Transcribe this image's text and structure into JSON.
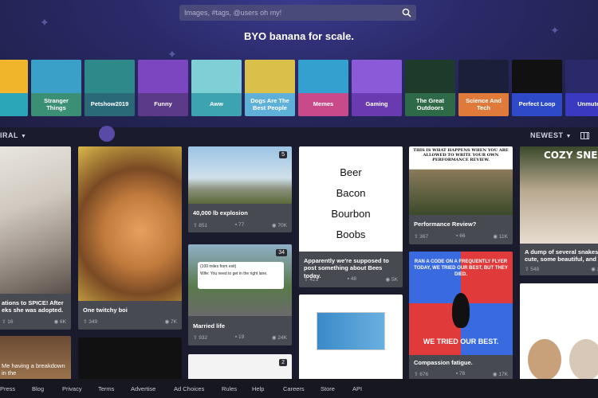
{
  "search": {
    "placeholder": "Images, #tags, @users oh my!"
  },
  "tagline": "BYO banana for scale.",
  "tags": [
    {
      "label": "",
      "art": "#f0b52a",
      "bg": "#2aa6b8"
    },
    {
      "label": "Stranger Things",
      "art": "#3aa0c8",
      "bg": "#3a8f74"
    },
    {
      "label": "Petshow2019",
      "art": "#2e8a8a",
      "bg": "#2a6a78"
    },
    {
      "label": "Funny",
      "art": "#7b46c0",
      "bg": "#5b3a8a"
    },
    {
      "label": "Aww",
      "art": "#7fd0d6",
      "bg": "#3ea3b0"
    },
    {
      "label": "Dogs Are The Best People",
      "art": "#d8c04a",
      "bg": "#5fb0d8"
    },
    {
      "label": "Memes",
      "art": "#33a0d0",
      "bg": "#c94a8a"
    },
    {
      "label": "Gaming",
      "art": "#8a5ad8",
      "bg": "#6a3ab0"
    },
    {
      "label": "The Great Outdoors",
      "art": "#1e3a2a",
      "bg": "#2f6a48"
    },
    {
      "label": "Science And Tech",
      "art": "#1a1f3a",
      "bg": "#e07a3a"
    },
    {
      "label": "Perfect Loop",
      "art": "#111",
      "bg": "#2f4ac8"
    },
    {
      "label": "Unmuted",
      "art": "#2a2a6a",
      "bg": "#3a3ac0"
    }
  ],
  "sort_left": "IRAL",
  "sort_right": "NEWEST",
  "cards": [
    {
      "title": "ations to SPICE! After eks she was adopted.",
      "ups": "16",
      "comments": "",
      "views": "6K",
      "badge": ""
    },
    {
      "title": "One twitchy boi",
      "ups": "349",
      "comments": "",
      "views": "7K",
      "badge": ""
    },
    {
      "title": "40,000 lb explosion",
      "ups": "851",
      "comments": "77",
      "views": "70K",
      "badge": "5"
    },
    {
      "title": "Married life",
      "ups": "932",
      "comments": "19",
      "views": "24K",
      "badge": "34"
    },
    {
      "title": "Apparently we're supposed to post something about Bees today.",
      "ups": "421",
      "comments": "48",
      "views": "5K",
      "badge": ""
    },
    {
      "title": "Performance Review?",
      "ups": "367",
      "comments": "66",
      "views": "11K",
      "badge": ""
    },
    {
      "title": "Compassion fatigue.",
      "ups": "676",
      "comments": "78",
      "views": "17K",
      "badge": ""
    },
    {
      "title": "A dump of several snakes: cute, some beautiful, and s",
      "ups": "548",
      "comments": "",
      "views": "24",
      "badge": ""
    },
    {
      "title": "",
      "ups": "",
      "comments": "",
      "views": "",
      "badge": "2"
    }
  ],
  "beer_list": [
    "Beer",
    "Bacon",
    "Bourbon",
    "Boobs"
  ],
  "meme_top": "THIS IS WHAT HAPPENS WHEN YOU ARE ALLOWED TO WRITE YOUR OWN PERFORMANCE REVIEW.",
  "penguin_top": "RAN A CODE ON A FREQUENTLY FLYER TODAY, WE TRIED OUR BEST, BUT THEY DIED.",
  "penguin_bottom": "WE TRIED OUR BEST.",
  "cozy": "COZY SNEK",
  "tweet_text": "(100 miles from exit)",
  "tweet_reply": "Wife: You need to get in the right lane.",
  "kitten_caption": "Me having a breakdown in the",
  "footer": [
    "Press",
    "Blog",
    "Privacy",
    "Terms",
    "Advertise",
    "Ad Choices",
    "Rules",
    "Help",
    "Careers",
    "Store",
    "API"
  ]
}
